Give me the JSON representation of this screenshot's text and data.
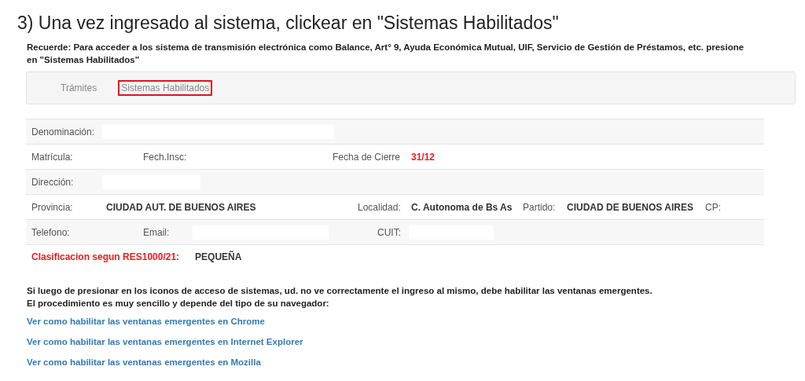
{
  "heading": "3) Una vez ingresado al sistema, clickear en \"Sistemas Habilitados\"",
  "notice": "Recuerde: Para acceder a los sistema de transmisión electrónica como Balance, Art° 9, Ayuda Económica Mutual, UIF, Servicio de Gestión de Préstamos, etc. presione en \"Sistemas Habilitados\"",
  "breadcrumb": [
    {
      "label": "Trámites",
      "highlighted": false
    },
    {
      "label": "Sistemas Habilitados",
      "highlighted": true
    }
  ],
  "rows": [
    {
      "cells": [
        {
          "kind": "label",
          "text": "Denominación:"
        },
        {
          "kind": "blank"
        }
      ]
    },
    {
      "cells": [
        {
          "kind": "label",
          "text": "Matrícula:"
        },
        {
          "kind": "label",
          "text": "Fech.Insc:"
        },
        {
          "kind": "label",
          "text": "Fecha de Cierre"
        },
        {
          "kind": "alert",
          "text": "31/12"
        }
      ]
    },
    {
      "cells": [
        {
          "kind": "label",
          "text": "Dirección:"
        },
        {
          "kind": "blank"
        }
      ]
    },
    {
      "cells": [
        {
          "kind": "label",
          "text": "Provincia:"
        },
        {
          "kind": "value",
          "text": "CIUDAD AUT. DE BUENOS AIRES"
        },
        {
          "kind": "label",
          "text": "Localidad:"
        },
        {
          "kind": "value",
          "text": "C. Autonoma de Bs As"
        },
        {
          "kind": "label",
          "text": "Partido:"
        },
        {
          "kind": "value",
          "text": "CIUDAD DE BUENOS AIRES"
        },
        {
          "kind": "label",
          "text": "CP:"
        }
      ]
    },
    {
      "cells": [
        {
          "kind": "label",
          "text": "Telefono:"
        },
        {
          "kind": "label",
          "text": "Email:"
        },
        {
          "kind": "blank"
        },
        {
          "kind": "label",
          "text": "CUIT:"
        },
        {
          "kind": "blank"
        }
      ]
    }
  ],
  "classification": {
    "label": "Clasificacion segun RES1000/21:",
    "value": "PEQUEÑA"
  },
  "popup_notice": [
    "Si luego de presionar en los iconos de acceso de sistemas, ud. no ve correctamente el ingreso al mismo, debe habilitar las ventanas emergentes.",
    "El procedimiento es muy sencillo y depende del tipo de su navegador:"
  ],
  "links": [
    "Ver como habilitar las ventanas emergentes en Chrome",
    "Ver como habilitar las ventanas emergentes en Internet Explorer",
    "Ver como habilitar las ventanas emergentes en Mozilla"
  ]
}
